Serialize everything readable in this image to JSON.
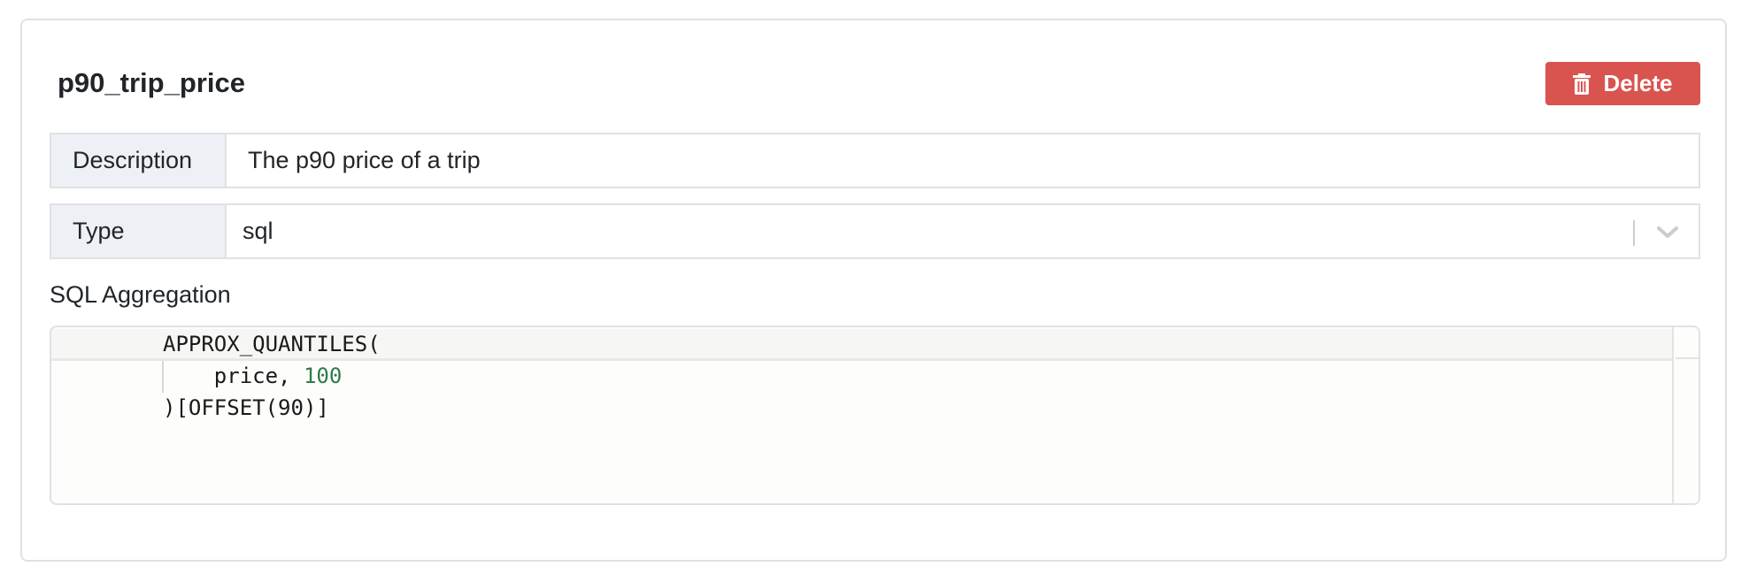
{
  "metric": {
    "name": "p90_trip_price"
  },
  "actions": {
    "delete_label": "Delete"
  },
  "description": {
    "label": "Description",
    "value": "The p90 price of a trip"
  },
  "type": {
    "label": "Type",
    "selected": "sql"
  },
  "sql_aggregation": {
    "label": "SQL Aggregation",
    "lines": [
      {
        "indent": "",
        "text": "APPROX_QUANTILES("
      },
      {
        "indent": "    ",
        "text": "price, ",
        "number": "100"
      },
      {
        "indent": "",
        "text": ")[OFFSET(90)]"
      }
    ]
  },
  "colors": {
    "danger": "#d9534f",
    "label_bg": "#edf1f6",
    "border": "#dee2e6",
    "number_literal": "#2f7a4a"
  },
  "icons": {
    "delete": "trash-icon",
    "select": "chevron-down-icon"
  }
}
